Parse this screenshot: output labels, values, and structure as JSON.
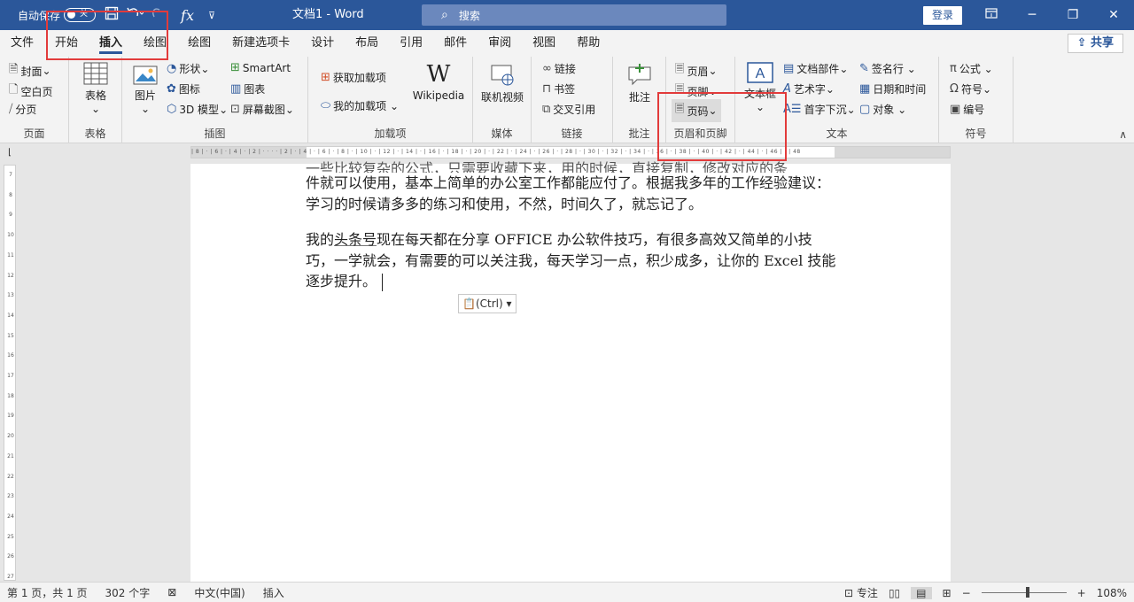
{
  "titlebar": {
    "autosave_label": "自动保存",
    "autosave_state": "关",
    "doc_title": "文档1  -  Word",
    "search_placeholder": "搜索",
    "login_label": "登录",
    "icons": [
      "save-icon",
      "undo-icon",
      "redo-icon",
      "fx-icon",
      "customize-qat-icon",
      "ribbon-display-icon",
      "minimize-icon",
      "restore-icon",
      "close-icon"
    ]
  },
  "tabs": {
    "items": [
      {
        "label": "文件"
      },
      {
        "label": "开始"
      },
      {
        "label": "插入",
        "active": true
      },
      {
        "label": "绘图"
      },
      {
        "label": "绘图"
      },
      {
        "label": "新建选项卡"
      },
      {
        "label": "设计"
      },
      {
        "label": "布局"
      },
      {
        "label": "引用"
      },
      {
        "label": "邮件"
      },
      {
        "label": "审阅"
      },
      {
        "label": "视图"
      },
      {
        "label": "帮助"
      }
    ],
    "share_label": "共享"
  },
  "ribbon": {
    "pages": {
      "label": "页面",
      "cover": "封面",
      "blank": "空白页",
      "break": "分页"
    },
    "tables": {
      "label": "表格",
      "table": "表格"
    },
    "illustrations": {
      "label": "插图",
      "pictures": "图片",
      "shapes": "形状",
      "icons": "图标",
      "model3d": "3D 模型",
      "smartart": "SmartArt",
      "chart": "图表",
      "screenshot": "屏幕截图"
    },
    "addins": {
      "label": "加载项",
      "get": "获取加载项",
      "my": "我的加载项",
      "wikipedia": "Wikipedia"
    },
    "media": {
      "label": "媒体",
      "online_video": "联机视频"
    },
    "links": {
      "label": "链接",
      "link": "链接",
      "bookmark": "书签",
      "cross_ref": "交叉引用"
    },
    "comments": {
      "label": "批注",
      "comment": "批注"
    },
    "header_footer": {
      "label": "页眉和页脚",
      "header": "页眉",
      "footer": "页脚",
      "page_number": "页码"
    },
    "text": {
      "label": "文本",
      "textbox": "文本框",
      "quick_parts": "文档部件",
      "wordart": "艺术字",
      "dropcap": "首字下沉",
      "signature": "签名行",
      "datetime": "日期和时间",
      "object": "对象"
    },
    "symbols": {
      "label": "符号",
      "equation": "公式",
      "symbol": "符号",
      "number": "编号"
    }
  },
  "document": {
    "para0": "一些比较复杂的公式，只需要收藏下来，用的时候，直接复制，修改对应的条",
    "para1": "件就可以使用，基本上简单的办公室工作都能应付了。根据我多年的工作经验建议：学习的时候请多多的练习和使用，不然，时间久了，就忘记了。",
    "para2_before": "我的",
    "para2_link": "头条号",
    "para2_after": "现在每天都在分享 OFFICE 办公软件技巧，有很多高效又简单的小技巧，一学就会，有需要的可以关注我，每天学习一点，积少成多，让你的 Excel 技能逐步提升。",
    "paste_options": "(Ctrl)"
  },
  "statusbar": {
    "page": "第 1 页，共 1 页",
    "words": "302 个字",
    "language": "中文(中国)",
    "mode": "插入",
    "focus": "专注",
    "zoom": "108%",
    "zoom_minus": "−",
    "zoom_plus": "+"
  }
}
